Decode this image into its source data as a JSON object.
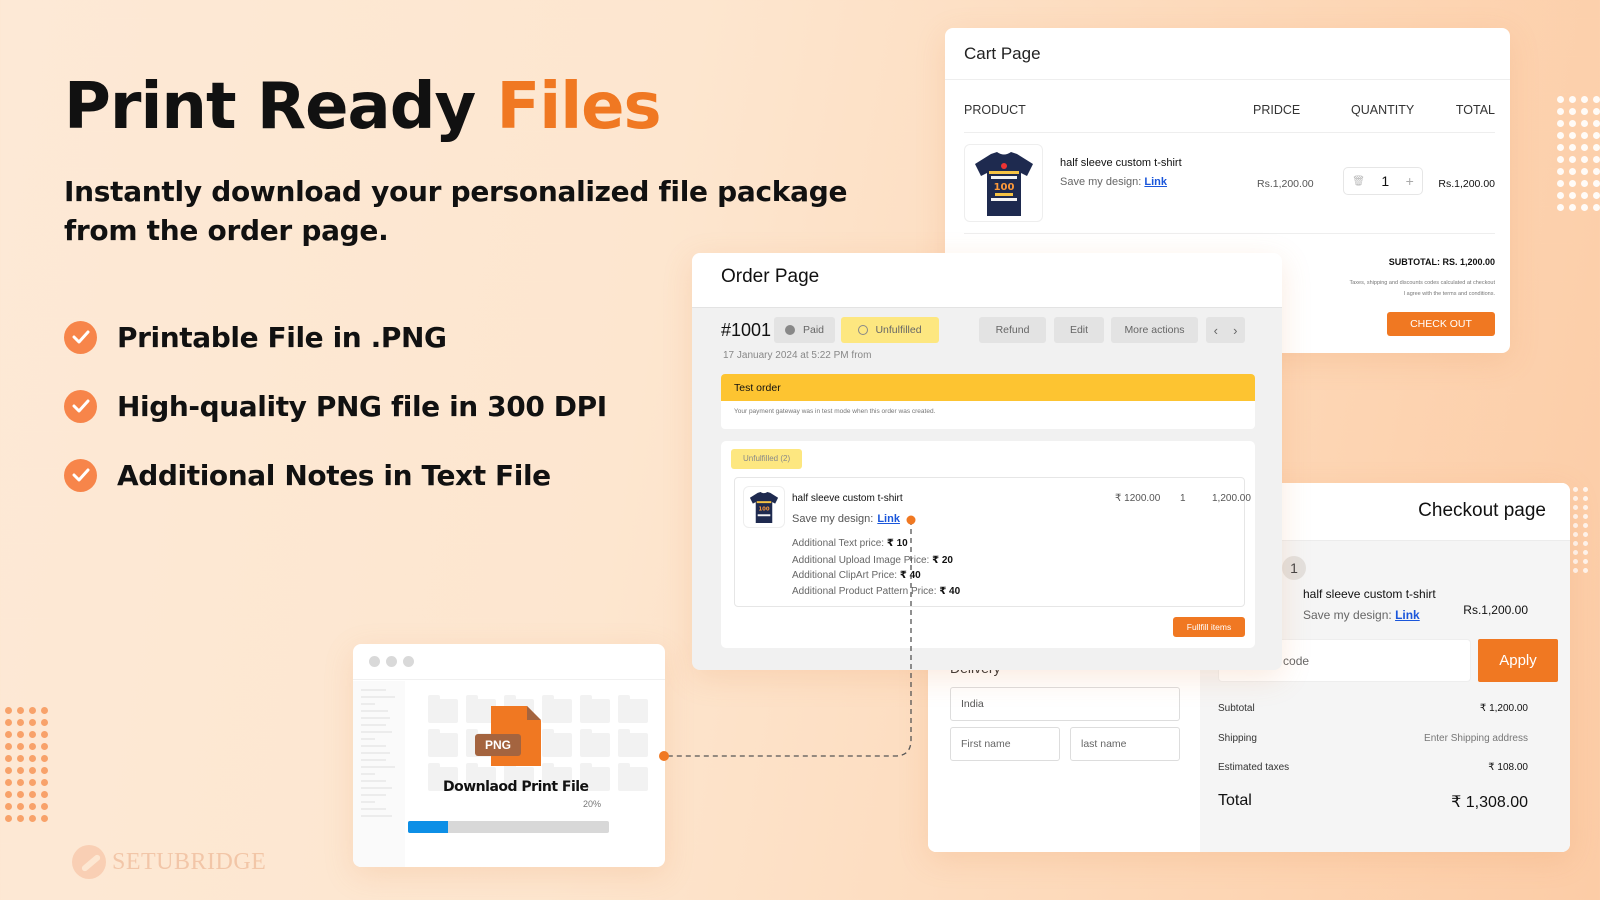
{
  "hero": {
    "title_main": "Print Ready ",
    "title_accent": "Files",
    "subtitle": "Instantly download your personalized file package from the order page.",
    "features": [
      {
        "label": "Printable File in .PNG",
        "icon": "check-circle-icon"
      },
      {
        "label": "High-quality PNG file in 300 DPI",
        "icon": "check-circle-icon"
      },
      {
        "label": "Additional Notes in Text File",
        "icon": "check-circle-icon"
      }
    ]
  },
  "brand": {
    "logo_text": "SETUBRIDGE",
    "accent_color": "#f07822"
  },
  "cart": {
    "title": "Cart Page",
    "columns": [
      "PRODUCT",
      "PRIDCE",
      "QUANTITY",
      "TOTAL"
    ],
    "item": {
      "name": "half sleeve custom t-shirt",
      "save_label": "Save my design:",
      "save_link": "Link",
      "price": "Rs.1,200.00",
      "quantity": "1",
      "total": "Rs.1,200.00"
    },
    "subtotal": "SUBTOTAL: RS. 1,200.00",
    "note1": "Taxes, shipping and discounts codes calculated at checkout",
    "note2": "I agree with the terms and conditions.",
    "checkout_button": "CHECK OUT"
  },
  "order": {
    "title": "Order Page",
    "id": "#1001",
    "paid_label": "Paid",
    "unfulfilled_label": "Unfulfilled",
    "actions": [
      "Refund",
      "Edit",
      "More actions"
    ],
    "prev_icon": "‹",
    "next_icon": "›",
    "date": "17 January 2024 at 5:22 PM from",
    "banner_title": "Test order",
    "banner_text": "Your payment gateway was in test mode when this order was created.",
    "unfulfilled_count": "Unfulfilled (2)",
    "line_item": {
      "name": "half sleeve custom t-shirt",
      "save_label": "Save my design:",
      "save_link": "Link",
      "price": "₹ 1200.00",
      "quantity": "1",
      "total": "1,200.00",
      "extras": [
        {
          "label": "Additional Text price:",
          "value": "₹ 10"
        },
        {
          "label": "Additional Upload Image Price:",
          "value": "₹ 20"
        },
        {
          "label": "Additional ClipArt Price:",
          "value": "₹ 40"
        },
        {
          "label": "Additional Product Pattern Price:",
          "value": "₹ 40"
        }
      ]
    },
    "fulfill_button": "Fullfill items"
  },
  "checkout": {
    "title": "Checkout page",
    "step": "1",
    "item": {
      "name": "half sleeve custom t-shirt",
      "save_label": "Save my design:",
      "save_link": "Link",
      "price": "Rs.1,200.00"
    },
    "discount_placeholder": "Discount code",
    "apply_button": "Apply",
    "summary": [
      {
        "label": "Subtotal",
        "value": "₹ 1,200.00"
      },
      {
        "label": "Shipping",
        "value": "Enter Shipping address"
      },
      {
        "label": "Estimated taxes",
        "value": "₹ 108.00"
      }
    ],
    "total_label": "Total",
    "total_value": "₹ 1,308.00",
    "delivery_label": "Delivery",
    "country_value": "India",
    "first_name_placeholder": "First name",
    "last_name_placeholder": "last name"
  },
  "download": {
    "file_type": "PNG",
    "title": "Downlaod Print File",
    "progress_label": "20%",
    "progress": 0.2
  }
}
